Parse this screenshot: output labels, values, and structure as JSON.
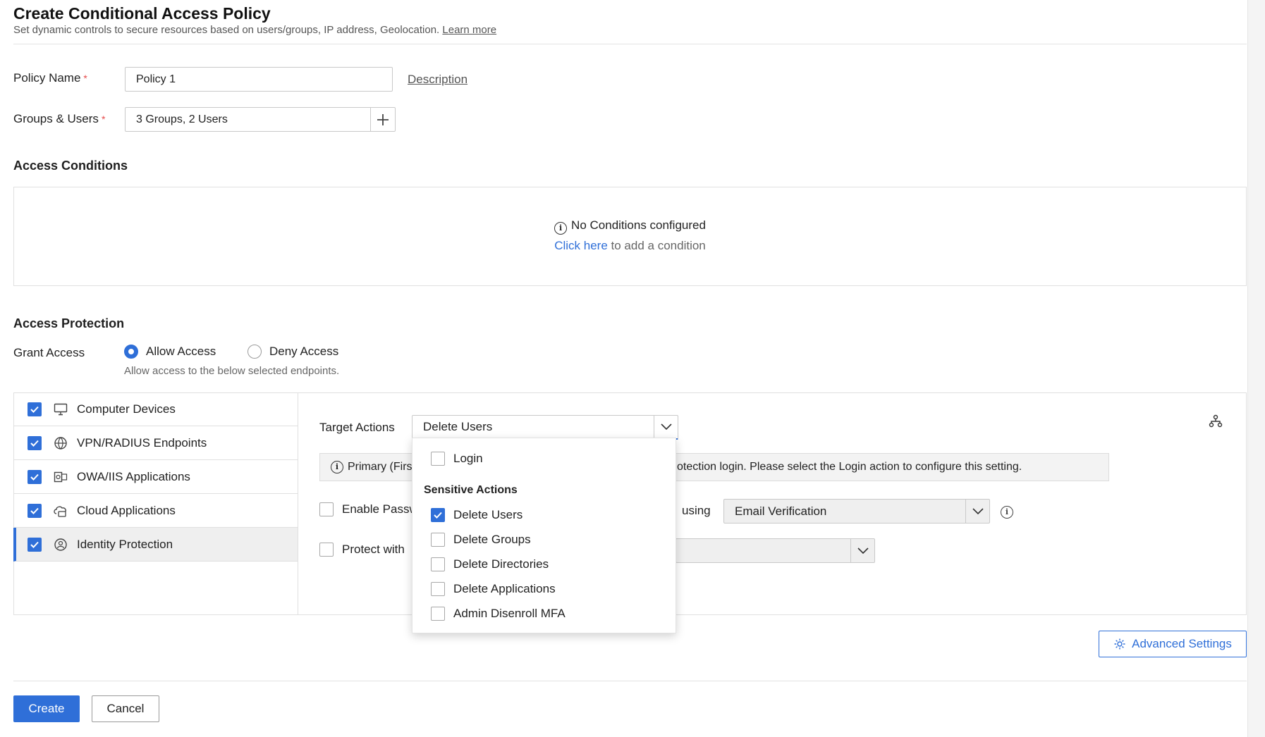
{
  "header": {
    "title": "Create Conditional Access Policy",
    "subtitle": "Set dynamic controls to secure resources based on users/groups, IP address, Geolocation.",
    "learn_more": "Learn more"
  },
  "form": {
    "policy_name_label": "Policy Name",
    "policy_name_value": "Policy 1",
    "description_link": "Description",
    "groups_users_label": "Groups & Users",
    "groups_users_value": "3 Groups, 2 Users",
    "required_mark": "*"
  },
  "access_conditions": {
    "heading": "Access Conditions",
    "empty_title": "No Conditions configured",
    "click_here": "Click here",
    "add_text": " to add a condition"
  },
  "access_protection": {
    "heading": "Access Protection",
    "grant_label": "Grant Access",
    "allow_label": "Allow Access",
    "deny_label": "Deny Access",
    "allow_hint": "Allow access to the below selected endpoints.",
    "selected": "allow"
  },
  "endpoints": [
    {
      "label": "Computer Devices",
      "checked": true,
      "icon": "monitor-icon"
    },
    {
      "label": "VPN/RADIUS Endpoints",
      "checked": true,
      "icon": "globe-network-icon"
    },
    {
      "label": "OWA/IIS Applications",
      "checked": true,
      "icon": "outlook-app-icon"
    },
    {
      "label": "Cloud Applications",
      "checked": true,
      "icon": "cloud-app-icon"
    },
    {
      "label": "Identity Protection",
      "checked": true,
      "icon": "identity-shield-icon",
      "active": true
    }
  ],
  "details": {
    "target_actions_label": "Target Actions",
    "target_actions_value": "Delete Users",
    "notice_prefix": "Primary (Firs",
    "notice_suffix": "otection login. Please select the Login action to configure this setting.",
    "enable_pw_label": "Enable Passw",
    "using_label": "using",
    "email_verification": "Email Verification",
    "protect_with_label": "Protect with"
  },
  "dropdown": {
    "login": "Login",
    "sensitive_heading": "Sensitive Actions",
    "items": [
      {
        "label": "Delete Users",
        "checked": true
      },
      {
        "label": "Delete Groups",
        "checked": false
      },
      {
        "label": "Delete Directories",
        "checked": false
      },
      {
        "label": "Delete Applications",
        "checked": false
      },
      {
        "label": "Admin Disenroll MFA",
        "checked": false
      }
    ]
  },
  "buttons": {
    "advanced_settings": "Advanced Settings",
    "create": "Create",
    "cancel": "Cancel"
  },
  "colors": {
    "accent": "#2f6fd8",
    "required": "#e54b4b",
    "border": "#e0e0e0"
  }
}
